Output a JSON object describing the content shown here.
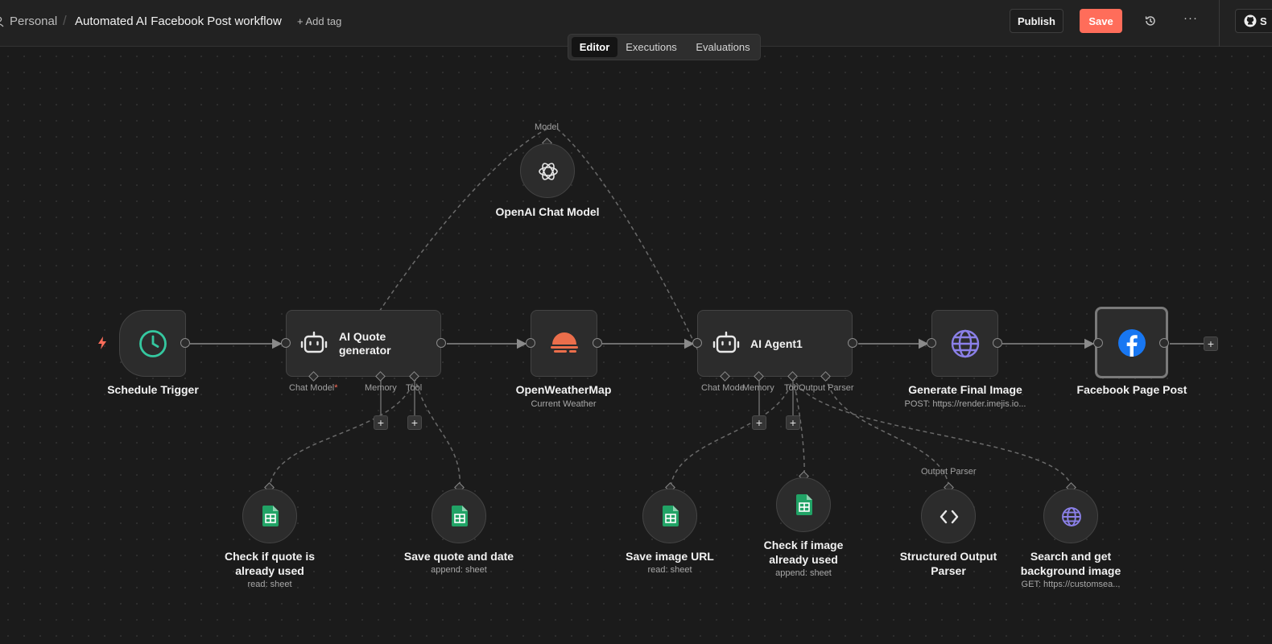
{
  "header": {
    "project": "Personal",
    "separator": "/",
    "workflow_name": "Automated AI Facebook Post workflow",
    "add_tag": "+ Add tag",
    "publish": "Publish",
    "save": "Save",
    "more": "···",
    "github_label": "S"
  },
  "tabs": {
    "editor": "Editor",
    "executions": "Executions",
    "evaluations": "Evaluations",
    "active": "Editor"
  },
  "nodes": {
    "schedule_trigger": {
      "title": "Schedule Trigger"
    },
    "ai_quote": {
      "title": "AI Quote generator",
      "ports": {
        "chat_model": "Chat Model",
        "req": "*",
        "memory": "Memory",
        "tool": "Tool"
      }
    },
    "openai_model": {
      "title": "OpenAI Chat Model",
      "port": "Model"
    },
    "openweathermap": {
      "title": "OpenWeatherMap",
      "subtitle": "Current Weather"
    },
    "ai_agent1": {
      "title": "AI Agent1",
      "ports": {
        "chat_model": "Chat Mode",
        "memory": "Memory",
        "tool": "Too",
        "output_parser": "Output Parser"
      }
    },
    "generate_final_image": {
      "title": "Generate Final Image",
      "subtitle": "POST: https://render.imejis.io..."
    },
    "facebook_page_post": {
      "title": "Facebook Page Post"
    },
    "check_quote": {
      "title": "Check if quote is already used",
      "subtitle": "read: sheet"
    },
    "save_quote": {
      "title": "Save quote and date",
      "subtitle": "append: sheet"
    },
    "save_image_url": {
      "title": "Save image URL",
      "subtitle": "read: sheet"
    },
    "check_image": {
      "title": "Check if image already used",
      "subtitle": "append: sheet"
    },
    "structured_parser": {
      "title": "Structured Output Parser",
      "port": "Output Parser"
    },
    "search_bg": {
      "title": "Search and get background image",
      "subtitle": "GET: https://customsea..."
    }
  },
  "plus": "+",
  "colors": {
    "accent": "#ff6d5a",
    "sheets_green": "#21a366",
    "weather_orange": "#eb6e4b",
    "http_purple": "#8b80e8",
    "facebook_blue": "#1877f2",
    "schedule_teal": "#35c8a0"
  }
}
